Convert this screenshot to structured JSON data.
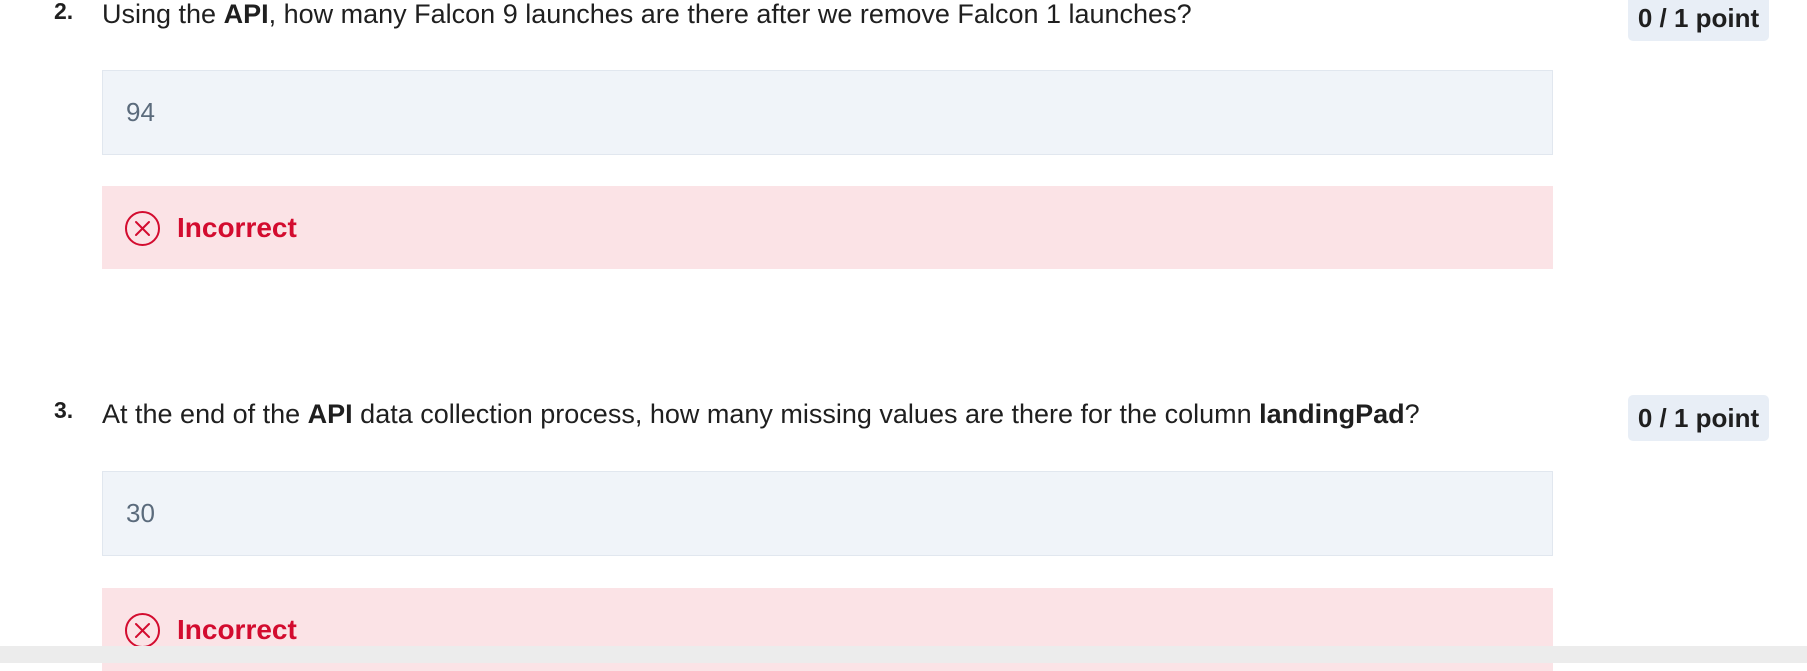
{
  "questions": [
    {
      "number": "2.",
      "text_parts": [
        "Using the ",
        "API",
        ", how many Falcon 9 launches are there after we remove Falcon 1 launches?"
      ],
      "points": "0 / 1 point",
      "answer": "94",
      "feedback": "Incorrect"
    },
    {
      "number": "3.",
      "text_parts": [
        "At the end of the ",
        "API",
        " data collection process, how many missing values are there for the column ",
        "landingPad",
        "?"
      ],
      "points": "0 / 1 point",
      "answer": "30",
      "feedback": "Incorrect"
    }
  ],
  "icons": {
    "feedback": "incorrect-circle-x-icon"
  },
  "colors": {
    "incorrect_text": "#d30c2f",
    "incorrect_background": "#fbe3e6",
    "answer_background": "#f0f4f9",
    "points_badge_background": "#e8eef6"
  }
}
